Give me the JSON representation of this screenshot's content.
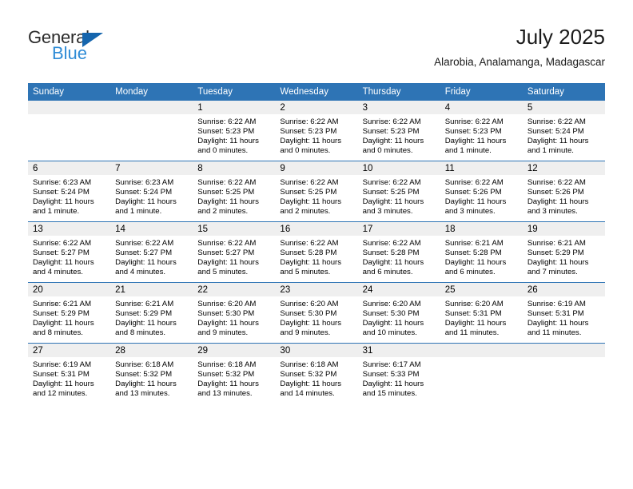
{
  "brand": {
    "name_top": "General",
    "name_bottom": "Blue",
    "triangle_color": "#1565ad",
    "blue_color": "#2e8bd6"
  },
  "header": {
    "title": "July 2025",
    "subtitle": "Alarobia, Analamanga, Madagascar"
  },
  "theme": {
    "header_blue": "#2e74b5",
    "row_divider_blue": "#2e74b5",
    "daynum_band_gray": "#efefef"
  },
  "calendar": {
    "weekday_headers": [
      "Sunday",
      "Monday",
      "Tuesday",
      "Wednesday",
      "Thursday",
      "Friday",
      "Saturday"
    ],
    "weeks": [
      [
        {
          "day": "",
          "sunrise": "",
          "sunset": "",
          "daylight1": "",
          "daylight2": ""
        },
        {
          "day": "",
          "sunrise": "",
          "sunset": "",
          "daylight1": "",
          "daylight2": ""
        },
        {
          "day": "1",
          "sunrise": "Sunrise: 6:22 AM",
          "sunset": "Sunset: 5:23 PM",
          "daylight1": "Daylight: 11 hours",
          "daylight2": "and 0 minutes."
        },
        {
          "day": "2",
          "sunrise": "Sunrise: 6:22 AM",
          "sunset": "Sunset: 5:23 PM",
          "daylight1": "Daylight: 11 hours",
          "daylight2": "and 0 minutes."
        },
        {
          "day": "3",
          "sunrise": "Sunrise: 6:22 AM",
          "sunset": "Sunset: 5:23 PM",
          "daylight1": "Daylight: 11 hours",
          "daylight2": "and 0 minutes."
        },
        {
          "day": "4",
          "sunrise": "Sunrise: 6:22 AM",
          "sunset": "Sunset: 5:23 PM",
          "daylight1": "Daylight: 11 hours",
          "daylight2": "and 1 minute."
        },
        {
          "day": "5",
          "sunrise": "Sunrise: 6:22 AM",
          "sunset": "Sunset: 5:24 PM",
          "daylight1": "Daylight: 11 hours",
          "daylight2": "and 1 minute."
        }
      ],
      [
        {
          "day": "6",
          "sunrise": "Sunrise: 6:23 AM",
          "sunset": "Sunset: 5:24 PM",
          "daylight1": "Daylight: 11 hours",
          "daylight2": "and 1 minute."
        },
        {
          "day": "7",
          "sunrise": "Sunrise: 6:23 AM",
          "sunset": "Sunset: 5:24 PM",
          "daylight1": "Daylight: 11 hours",
          "daylight2": "and 1 minute."
        },
        {
          "day": "8",
          "sunrise": "Sunrise: 6:22 AM",
          "sunset": "Sunset: 5:25 PM",
          "daylight1": "Daylight: 11 hours",
          "daylight2": "and 2 minutes."
        },
        {
          "day": "9",
          "sunrise": "Sunrise: 6:22 AM",
          "sunset": "Sunset: 5:25 PM",
          "daylight1": "Daylight: 11 hours",
          "daylight2": "and 2 minutes."
        },
        {
          "day": "10",
          "sunrise": "Sunrise: 6:22 AM",
          "sunset": "Sunset: 5:25 PM",
          "daylight1": "Daylight: 11 hours",
          "daylight2": "and 3 minutes."
        },
        {
          "day": "11",
          "sunrise": "Sunrise: 6:22 AM",
          "sunset": "Sunset: 5:26 PM",
          "daylight1": "Daylight: 11 hours",
          "daylight2": "and 3 minutes."
        },
        {
          "day": "12",
          "sunrise": "Sunrise: 6:22 AM",
          "sunset": "Sunset: 5:26 PM",
          "daylight1": "Daylight: 11 hours",
          "daylight2": "and 3 minutes."
        }
      ],
      [
        {
          "day": "13",
          "sunrise": "Sunrise: 6:22 AM",
          "sunset": "Sunset: 5:27 PM",
          "daylight1": "Daylight: 11 hours",
          "daylight2": "and 4 minutes."
        },
        {
          "day": "14",
          "sunrise": "Sunrise: 6:22 AM",
          "sunset": "Sunset: 5:27 PM",
          "daylight1": "Daylight: 11 hours",
          "daylight2": "and 4 minutes."
        },
        {
          "day": "15",
          "sunrise": "Sunrise: 6:22 AM",
          "sunset": "Sunset: 5:27 PM",
          "daylight1": "Daylight: 11 hours",
          "daylight2": "and 5 minutes."
        },
        {
          "day": "16",
          "sunrise": "Sunrise: 6:22 AM",
          "sunset": "Sunset: 5:28 PM",
          "daylight1": "Daylight: 11 hours",
          "daylight2": "and 5 minutes."
        },
        {
          "day": "17",
          "sunrise": "Sunrise: 6:22 AM",
          "sunset": "Sunset: 5:28 PM",
          "daylight1": "Daylight: 11 hours",
          "daylight2": "and 6 minutes."
        },
        {
          "day": "18",
          "sunrise": "Sunrise: 6:21 AM",
          "sunset": "Sunset: 5:28 PM",
          "daylight1": "Daylight: 11 hours",
          "daylight2": "and 6 minutes."
        },
        {
          "day": "19",
          "sunrise": "Sunrise: 6:21 AM",
          "sunset": "Sunset: 5:29 PM",
          "daylight1": "Daylight: 11 hours",
          "daylight2": "and 7 minutes."
        }
      ],
      [
        {
          "day": "20",
          "sunrise": "Sunrise: 6:21 AM",
          "sunset": "Sunset: 5:29 PM",
          "daylight1": "Daylight: 11 hours",
          "daylight2": "and 8 minutes."
        },
        {
          "day": "21",
          "sunrise": "Sunrise: 6:21 AM",
          "sunset": "Sunset: 5:29 PM",
          "daylight1": "Daylight: 11 hours",
          "daylight2": "and 8 minutes."
        },
        {
          "day": "22",
          "sunrise": "Sunrise: 6:20 AM",
          "sunset": "Sunset: 5:30 PM",
          "daylight1": "Daylight: 11 hours",
          "daylight2": "and 9 minutes."
        },
        {
          "day": "23",
          "sunrise": "Sunrise: 6:20 AM",
          "sunset": "Sunset: 5:30 PM",
          "daylight1": "Daylight: 11 hours",
          "daylight2": "and 9 minutes."
        },
        {
          "day": "24",
          "sunrise": "Sunrise: 6:20 AM",
          "sunset": "Sunset: 5:30 PM",
          "daylight1": "Daylight: 11 hours",
          "daylight2": "and 10 minutes."
        },
        {
          "day": "25",
          "sunrise": "Sunrise: 6:20 AM",
          "sunset": "Sunset: 5:31 PM",
          "daylight1": "Daylight: 11 hours",
          "daylight2": "and 11 minutes."
        },
        {
          "day": "26",
          "sunrise": "Sunrise: 6:19 AM",
          "sunset": "Sunset: 5:31 PM",
          "daylight1": "Daylight: 11 hours",
          "daylight2": "and 11 minutes."
        }
      ],
      [
        {
          "day": "27",
          "sunrise": "Sunrise: 6:19 AM",
          "sunset": "Sunset: 5:31 PM",
          "daylight1": "Daylight: 11 hours",
          "daylight2": "and 12 minutes."
        },
        {
          "day": "28",
          "sunrise": "Sunrise: 6:18 AM",
          "sunset": "Sunset: 5:32 PM",
          "daylight1": "Daylight: 11 hours",
          "daylight2": "and 13 minutes."
        },
        {
          "day": "29",
          "sunrise": "Sunrise: 6:18 AM",
          "sunset": "Sunset: 5:32 PM",
          "daylight1": "Daylight: 11 hours",
          "daylight2": "and 13 minutes."
        },
        {
          "day": "30",
          "sunrise": "Sunrise: 6:18 AM",
          "sunset": "Sunset: 5:32 PM",
          "daylight1": "Daylight: 11 hours",
          "daylight2": "and 14 minutes."
        },
        {
          "day": "31",
          "sunrise": "Sunrise: 6:17 AM",
          "sunset": "Sunset: 5:33 PM",
          "daylight1": "Daylight: 11 hours",
          "daylight2": "and 15 minutes."
        },
        {
          "day": "",
          "sunrise": "",
          "sunset": "",
          "daylight1": "",
          "daylight2": ""
        },
        {
          "day": "",
          "sunrise": "",
          "sunset": "",
          "daylight1": "",
          "daylight2": ""
        }
      ]
    ]
  }
}
